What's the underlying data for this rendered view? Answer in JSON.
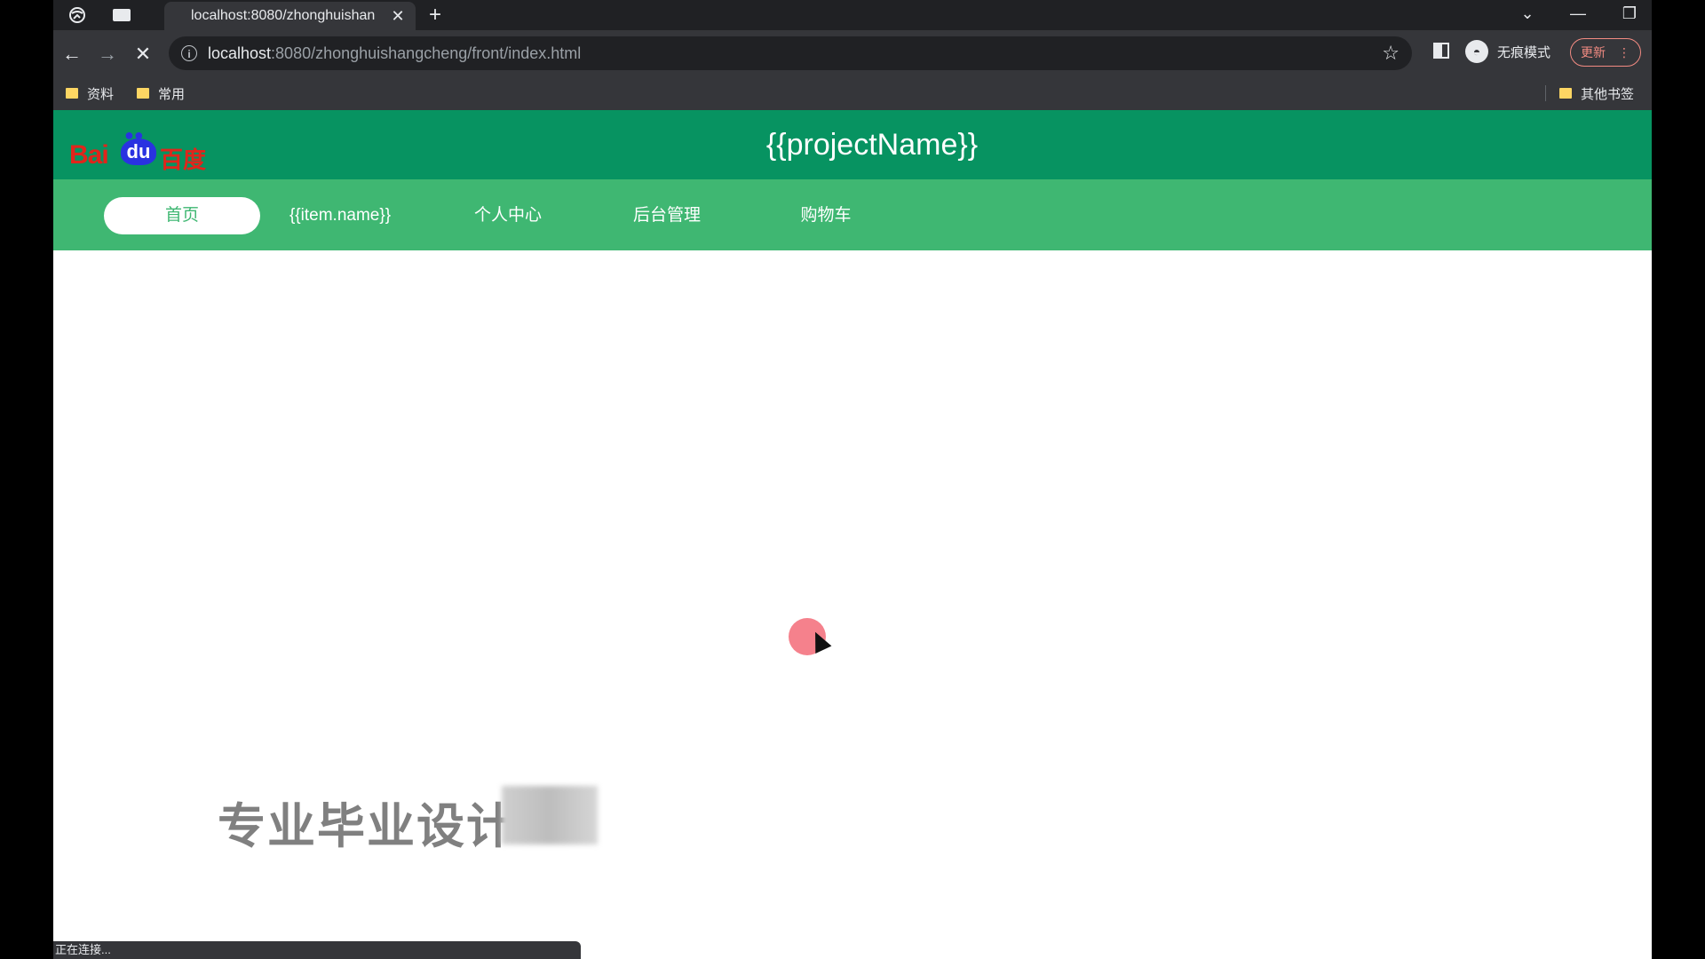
{
  "browser": {
    "tab_title": "localhost:8080/zhonghuishan",
    "url_host": "localhost",
    "url_rest": ":8080/zhonghuishangcheng/front/index.html",
    "incognito_label": "无痕模式",
    "update_label": "更新",
    "bookmarks": [
      "资料",
      "常用"
    ],
    "other_bookmarks": "其他书签",
    "status_text": "正在连接..."
  },
  "site": {
    "logo_bai": "Bai",
    "logo_du": "du",
    "logo_cn": "百度",
    "project_name": "{{projectName}}",
    "nav": [
      {
        "label": "首页",
        "active": true
      },
      {
        "label": "{{item.name}}"
      },
      {
        "label": "个人中心"
      },
      {
        "label": "后台管理"
      },
      {
        "label": "购物车"
      }
    ]
  },
  "overlay": {
    "watermark_text": "专业毕业设计"
  },
  "colors": {
    "header": "#079361",
    "nav": "#3fb772",
    "cursor_halo": "#f47a86"
  }
}
